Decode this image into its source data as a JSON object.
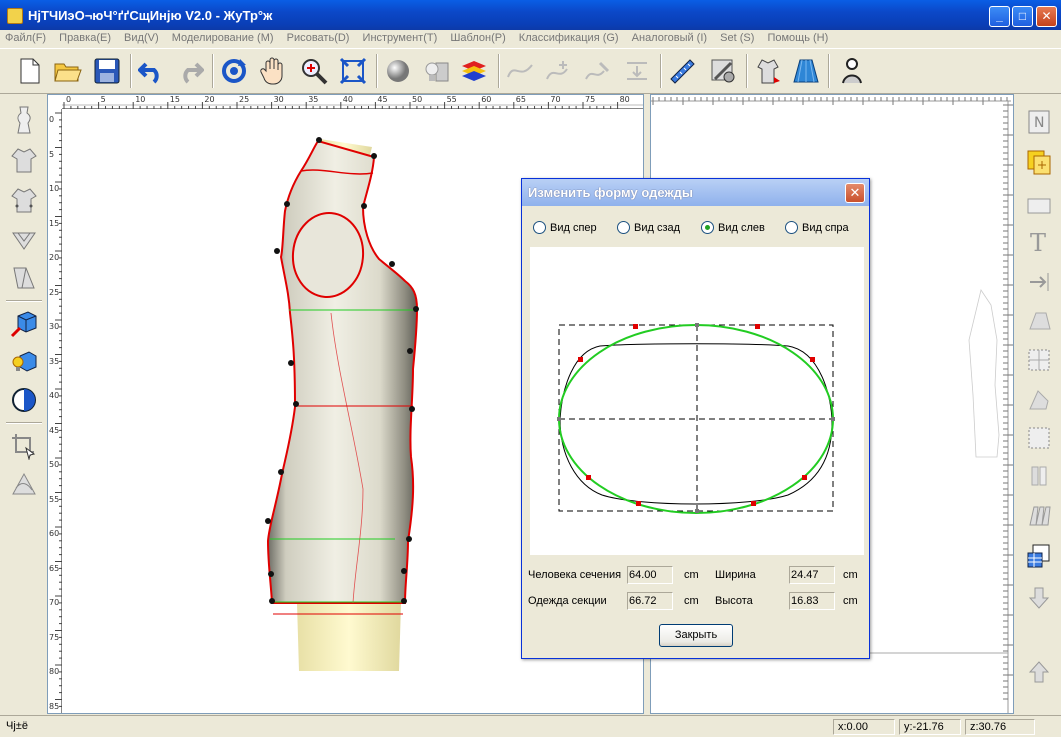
{
  "window": {
    "title": "НјТЧИэО¬юЧ°ґґСщИнјю V2.0 - ЖуТр°ж"
  },
  "menu": [
    "Файл(F)",
    "Правка(E)",
    "Вид(V)",
    "Моделирование (M)",
    "Рисовать(D)",
    "Инструмент(T)",
    "Шаблон(P)",
    "Классификация (G)",
    "Аналоговый (I)",
    "Set (S)",
    "Помощь (H)"
  ],
  "toolbar_icons": [
    "new-file-icon",
    "open-folder-icon",
    "save-icon",
    "undo-icon",
    "redo-icon",
    "rotate-icon",
    "pan-hand-icon",
    "zoom-icon",
    "fit-view-icon",
    "sphere-icon",
    "lamp-icon",
    "layers-icon",
    "curve-icon",
    "add-point-icon",
    "edit-curve-icon",
    "align-icon",
    "measure-ruler-icon",
    "settings-icon",
    "garment-shirt-icon",
    "skirt-icon",
    "mannequin-icon"
  ],
  "ruler_top_labels": [
    "0",
    "5",
    "10",
    "15",
    "20",
    "25",
    "30",
    "35",
    "40",
    "45",
    "50",
    "55",
    "60",
    "65",
    "70",
    "75",
    "80"
  ],
  "ruler_left_labels": [
    "0",
    "5",
    "10",
    "15",
    "20",
    "25",
    "30",
    "35",
    "40",
    "45",
    "50",
    "55",
    "60",
    "65",
    "70",
    "75",
    "80",
    "85"
  ],
  "dialog": {
    "title": "Изменить форму одежды",
    "views": [
      {
        "label": "Вид спер",
        "selected": false
      },
      {
        "label": "Вид сзад",
        "selected": false
      },
      {
        "label": "Вид слев",
        "selected": true
      },
      {
        "label": "Вид спра",
        "selected": false
      }
    ],
    "human_section_label": "Человека сечения",
    "human_section_value": "64.00",
    "garment_section_label": "Одежда секции",
    "garment_section_value": "66.72",
    "unit": "cm",
    "width_label": "Ширина",
    "width_value": "24.47",
    "height_label": "Высота",
    "height_value": "16.83",
    "close_button": "Закрыть"
  },
  "status": {
    "left": "Чј±ё",
    "x": "x:0.00",
    "y": "y:-21.76",
    "z": "z:30.76"
  },
  "colors": {
    "selection_red": "#e00000",
    "section_green": "#22cc22",
    "titlebar_blue": "#0a4fd6"
  }
}
